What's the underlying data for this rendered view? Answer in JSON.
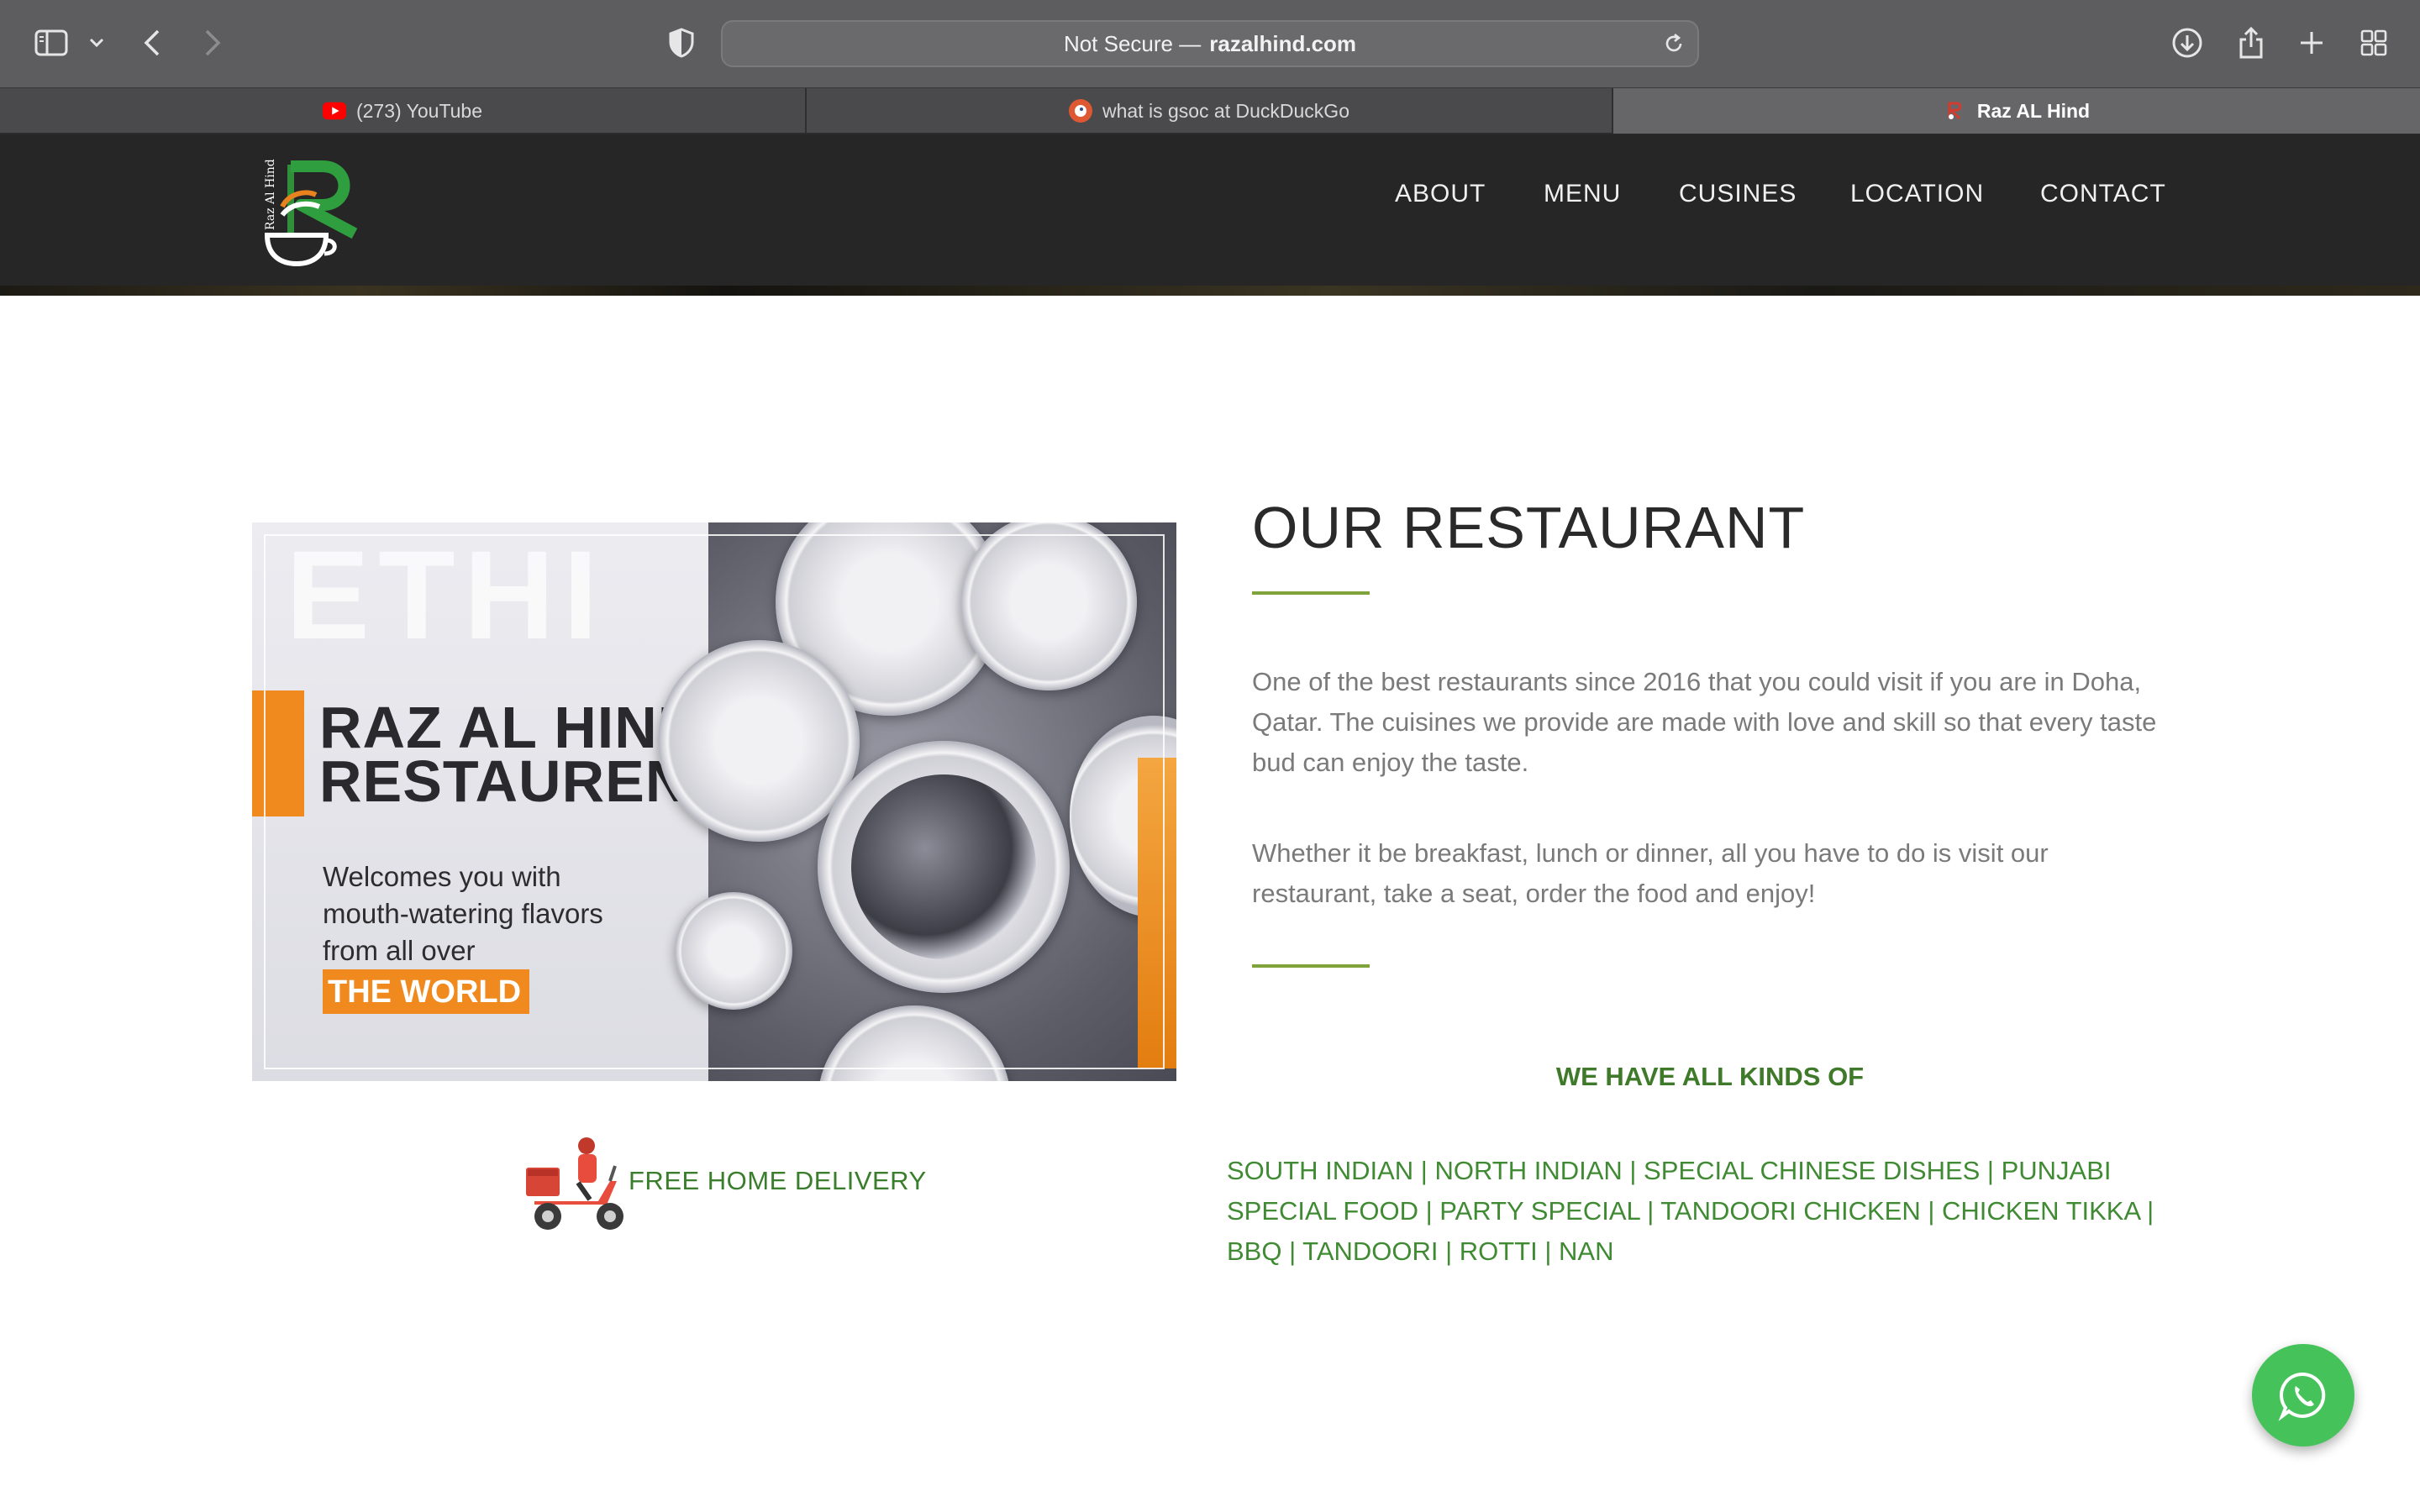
{
  "browser": {
    "address": {
      "prefix": "Not Secure —",
      "domain": "razalhind.com"
    },
    "tabs": [
      {
        "label": "(273) YouTube",
        "icon": "youtube-icon"
      },
      {
        "label": "what is gsoc at DuckDuckGo",
        "icon": "duckduckgo-icon"
      },
      {
        "label": "Raz AL Hind",
        "icon": "site-favicon",
        "active": true
      }
    ]
  },
  "site": {
    "logo_text": "Raz Al Hind",
    "nav": [
      "ABOUT",
      "MENU",
      "CUSINES",
      "LOCATION",
      "CONTACT"
    ]
  },
  "promo": {
    "ghost_text": "ETHI",
    "title_line1": "RAZ AL HIND",
    "title_line2": "RESTAURENT",
    "subtitle": "Welcomes you with mouth-watering flavors from all over",
    "highlight": "THE WORLD"
  },
  "delivery": {
    "label": "FREE HOME DELIVERY"
  },
  "about": {
    "title": "OUR RESTAURANT",
    "para1": "One of the best restaurants since 2016 that you could visit if you are in Doha, Qatar. The cuisines we provide are made with love and skill so that every taste bud can enjoy the taste.",
    "para2": "Whether it be breakfast, lunch or dinner, all you have to do is visit our restaurant, take a seat, order the food and enjoy!",
    "kinds_title": "WE HAVE ALL KINDS OF",
    "kinds_list": "SOUTH INDIAN | NORTH INDIAN | SPECIAL CHINESE DISHES | PUNJABI SPECIAL FOOD | PARTY SPECIAL | TANDOORI CHICKEN | CHICKEN TIKKA | BBQ | TANDOORI | ROTTI | NAN"
  },
  "colors": {
    "accent_green": "#3f7a2a",
    "rule_green": "#7fa33a",
    "promo_orange": "#f08a1e",
    "whatsapp_green": "#45c35a",
    "header_bg": "#262626"
  }
}
